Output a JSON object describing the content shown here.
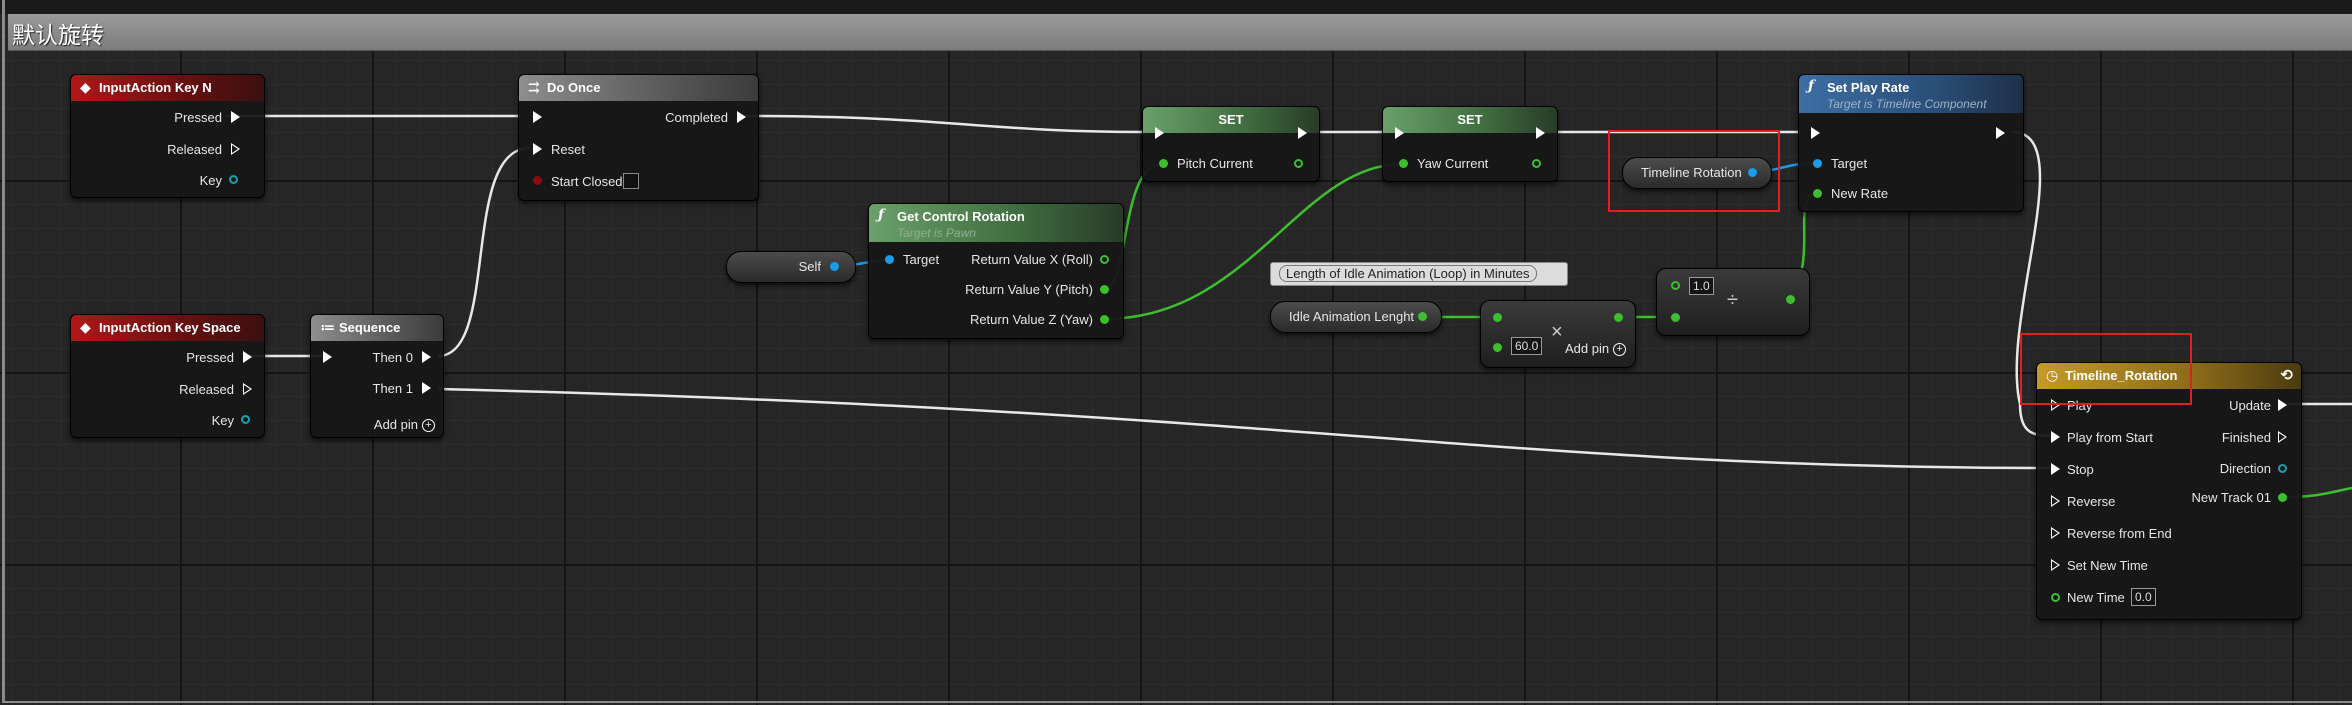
{
  "graph": {
    "title": "默认旋转"
  },
  "colors": {
    "exec": "#ffffff",
    "float": "#3dbe2f",
    "object": "#1c9be8",
    "highlight": "#e02020",
    "event_header": "#b01818",
    "timeline_header": "#c59a28"
  },
  "nodes": {
    "input_n": {
      "title": "InputAction Key N",
      "pressed": "Pressed",
      "released": "Released",
      "key": "Key"
    },
    "do_once": {
      "title": "Do Once",
      "completed": "Completed",
      "reset": "Reset",
      "start_closed": "Start Closed"
    },
    "set_pitch": {
      "title": "SET",
      "pin": "Pitch Current"
    },
    "set_yaw": {
      "title": "SET",
      "pin": "Yaw Current"
    },
    "timeline_var": {
      "label": "Timeline Rotation"
    },
    "set_play_rate": {
      "title": "Set Play Rate",
      "subtitle": "Target is Timeline Component",
      "target": "Target",
      "new_rate": "New Rate"
    },
    "input_space": {
      "title": "InputAction Key Space",
      "pressed": "Pressed",
      "released": "Released",
      "key": "Key"
    },
    "sequence": {
      "title": "Sequence",
      "then0": "Then 0",
      "then1": "Then 1",
      "add_pin": "Add pin"
    },
    "self_node": {
      "label": "Self"
    },
    "get_control_rotation": {
      "title": "Get Control Rotation",
      "subtitle": "Target is Pawn",
      "target": "Target",
      "roll": "Return Value X (Roll)",
      "pitch": "Return Value Y (Pitch)",
      "yaw": "Return Value Z (Yaw)"
    },
    "comment": {
      "text": "Length of Idle Animation (Loop) in Minutes"
    },
    "idle_var": {
      "label": "Idle Animation Lenght"
    },
    "multiply": {
      "value": "60.0",
      "add_pin": "Add pin",
      "symbol": "×"
    },
    "divide": {
      "value": "1.0",
      "symbol": "÷"
    },
    "timeline": {
      "title": "Timeline_Rotation",
      "play": "Play",
      "play_from_start": "Play from Start",
      "stop": "Stop",
      "reverse": "Reverse",
      "reverse_from_end": "Reverse from End",
      "set_new_time": "Set New Time",
      "new_time": "New Time",
      "new_time_value": "0.0",
      "update": "Update",
      "finished": "Finished",
      "direction": "Direction",
      "new_track": "New Track 01"
    }
  },
  "icons": {
    "event": "event-diamond-icon",
    "function": "function-f-icon",
    "timeline": "clock-icon",
    "sequence": "sequence-icon",
    "loop": "loop-icon"
  }
}
